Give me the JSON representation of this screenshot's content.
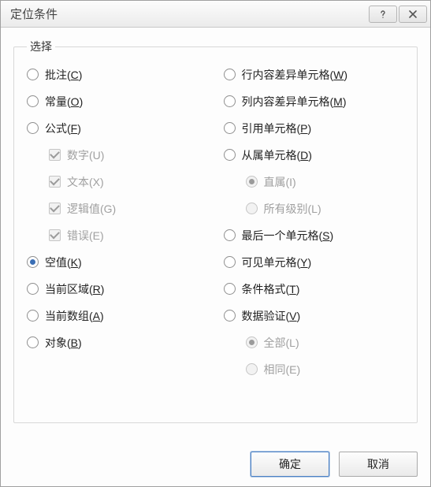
{
  "title": "定位条件",
  "groupLabel": "选择",
  "left": [
    {
      "type": "radio",
      "label": "批注",
      "mn": "C",
      "selected": false
    },
    {
      "type": "radio",
      "label": "常量",
      "mn": "O",
      "selected": false
    },
    {
      "type": "radio",
      "label": "公式",
      "mn": "F",
      "selected": false
    },
    {
      "type": "check",
      "label": "数字(U)",
      "indent": true,
      "disabled": true,
      "checked": true
    },
    {
      "type": "check",
      "label": "文本(X)",
      "indent": true,
      "disabled": true,
      "checked": true
    },
    {
      "type": "check",
      "label": "逻辑值(G)",
      "indent": true,
      "disabled": true,
      "checked": true
    },
    {
      "type": "check",
      "label": "错误(E)",
      "indent": true,
      "disabled": true,
      "checked": true
    },
    {
      "type": "radio",
      "label": "空值",
      "mn": "K",
      "selected": true
    },
    {
      "type": "radio",
      "label": "当前区域",
      "mn": "R",
      "selected": false
    },
    {
      "type": "radio",
      "label": "当前数组",
      "mn": "A",
      "selected": false
    },
    {
      "type": "radio",
      "label": "对象",
      "mn": "B",
      "selected": false
    }
  ],
  "right": [
    {
      "type": "radio",
      "label": "行内容差异单元格",
      "mn": "W",
      "selected": false
    },
    {
      "type": "radio",
      "label": "列内容差异单元格",
      "mn": "M",
      "selected": false
    },
    {
      "type": "radio",
      "label": "引用单元格",
      "mn": "P",
      "selected": false
    },
    {
      "type": "radio",
      "label": "从属单元格",
      "mn": "D",
      "selected": false
    },
    {
      "type": "radio",
      "label": "直属(I)",
      "indent": true,
      "disabled": true,
      "selected": true
    },
    {
      "type": "radio",
      "label": "所有级别(L)",
      "indent": true,
      "disabled": true,
      "selected": false
    },
    {
      "type": "radio",
      "label": "最后一个单元格",
      "mn": "S",
      "selected": false
    },
    {
      "type": "radio",
      "label": "可见单元格",
      "mn": "Y",
      "selected": false
    },
    {
      "type": "radio",
      "label": "条件格式",
      "mn": "T",
      "selected": false
    },
    {
      "type": "radio",
      "label": "数据验证",
      "mn": "V",
      "selected": false
    },
    {
      "type": "radio",
      "label": "全部(L)",
      "indent": true,
      "disabled": true,
      "selected": true
    },
    {
      "type": "radio",
      "label": "相同(E)",
      "indent": true,
      "disabled": true,
      "selected": false
    }
  ],
  "buttons": {
    "ok": "确定",
    "cancel": "取消"
  }
}
